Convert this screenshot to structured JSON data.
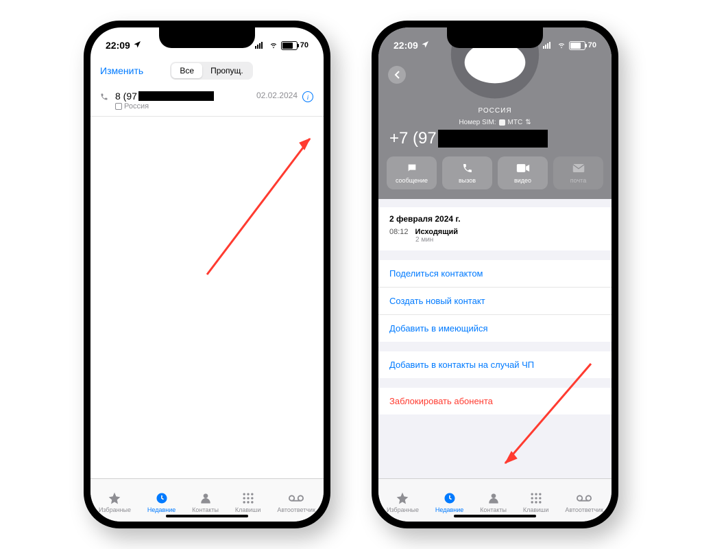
{
  "status": {
    "time": "22:09",
    "battery": "70"
  },
  "left": {
    "edit": "Изменить",
    "seg_all": "Все",
    "seg_missed": "Пропущ.",
    "call": {
      "number_prefix": "8 (97",
      "sub": "Россия",
      "date": "02.02.2024"
    }
  },
  "tabs": {
    "fav": "Избранные",
    "recent": "Недавние",
    "contacts": "Контакты",
    "keypad": "Клавиши",
    "vm": "Автоответчик"
  },
  "right": {
    "country": "РОССИЯ",
    "sim_label": "Номер SIM:",
    "sim_op": "МТС",
    "number_prefix": "+7 (97",
    "actions": {
      "message": "сообщение",
      "call": "вызов",
      "video": "видео",
      "mail": "почта"
    },
    "log": {
      "date": "2 февраля 2024 г.",
      "time": "08:12",
      "direction": "Исходящий",
      "duration": "2 мин"
    },
    "options": {
      "share": "Поделиться контактом",
      "create": "Создать новый контакт",
      "add": "Добавить в имеющийся",
      "emergency": "Добавить в контакты на случай ЧП",
      "block": "Заблокировать абонента"
    }
  }
}
